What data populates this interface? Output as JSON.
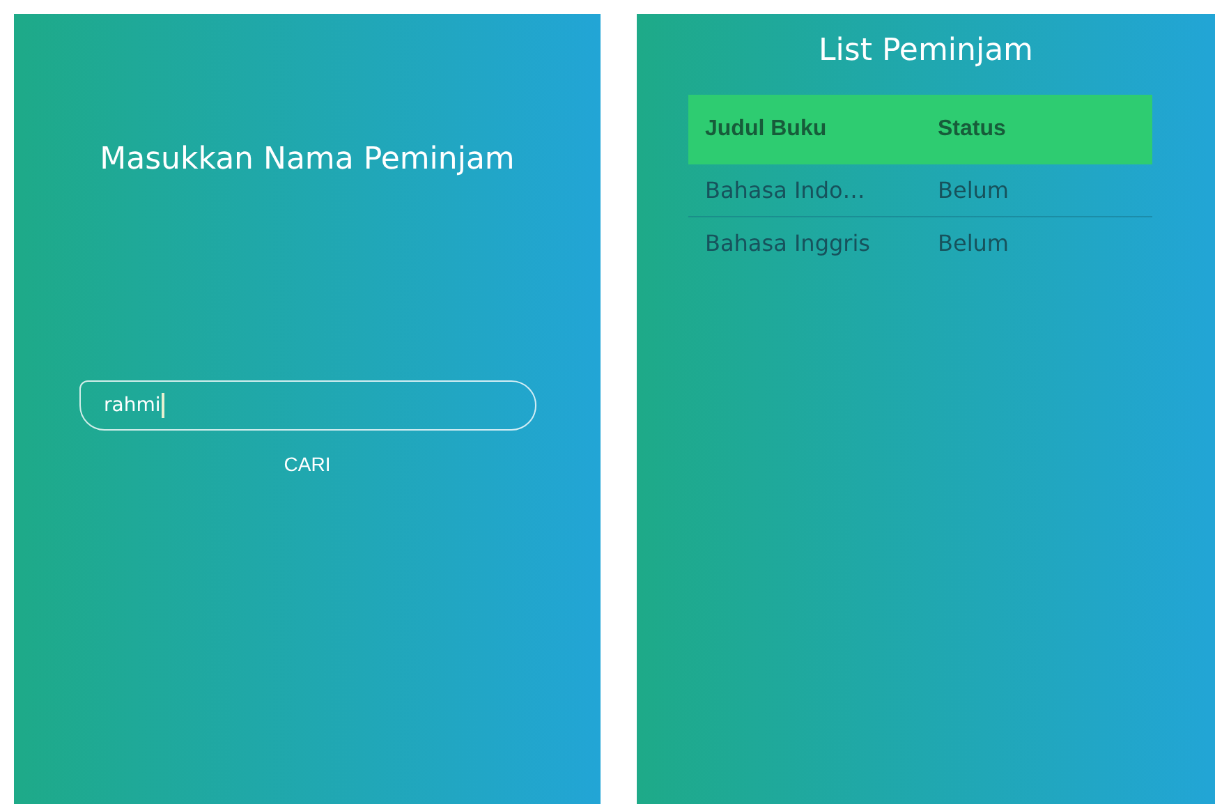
{
  "search_screen": {
    "title": "Masukkan Nama Peminjam",
    "name_field": {
      "value": "rahmi",
      "focused": true
    },
    "search_button": "CARI"
  },
  "list_screen": {
    "title": "List Peminjam",
    "table": {
      "columns": [
        "Judul Buku",
        "Status"
      ],
      "rows": [
        {
          "cells": [
            "Bahasa Indo…",
            "Belum"
          ]
        },
        {
          "cells": [
            "Bahasa Inggris",
            "Belum"
          ]
        }
      ]
    }
  }
}
